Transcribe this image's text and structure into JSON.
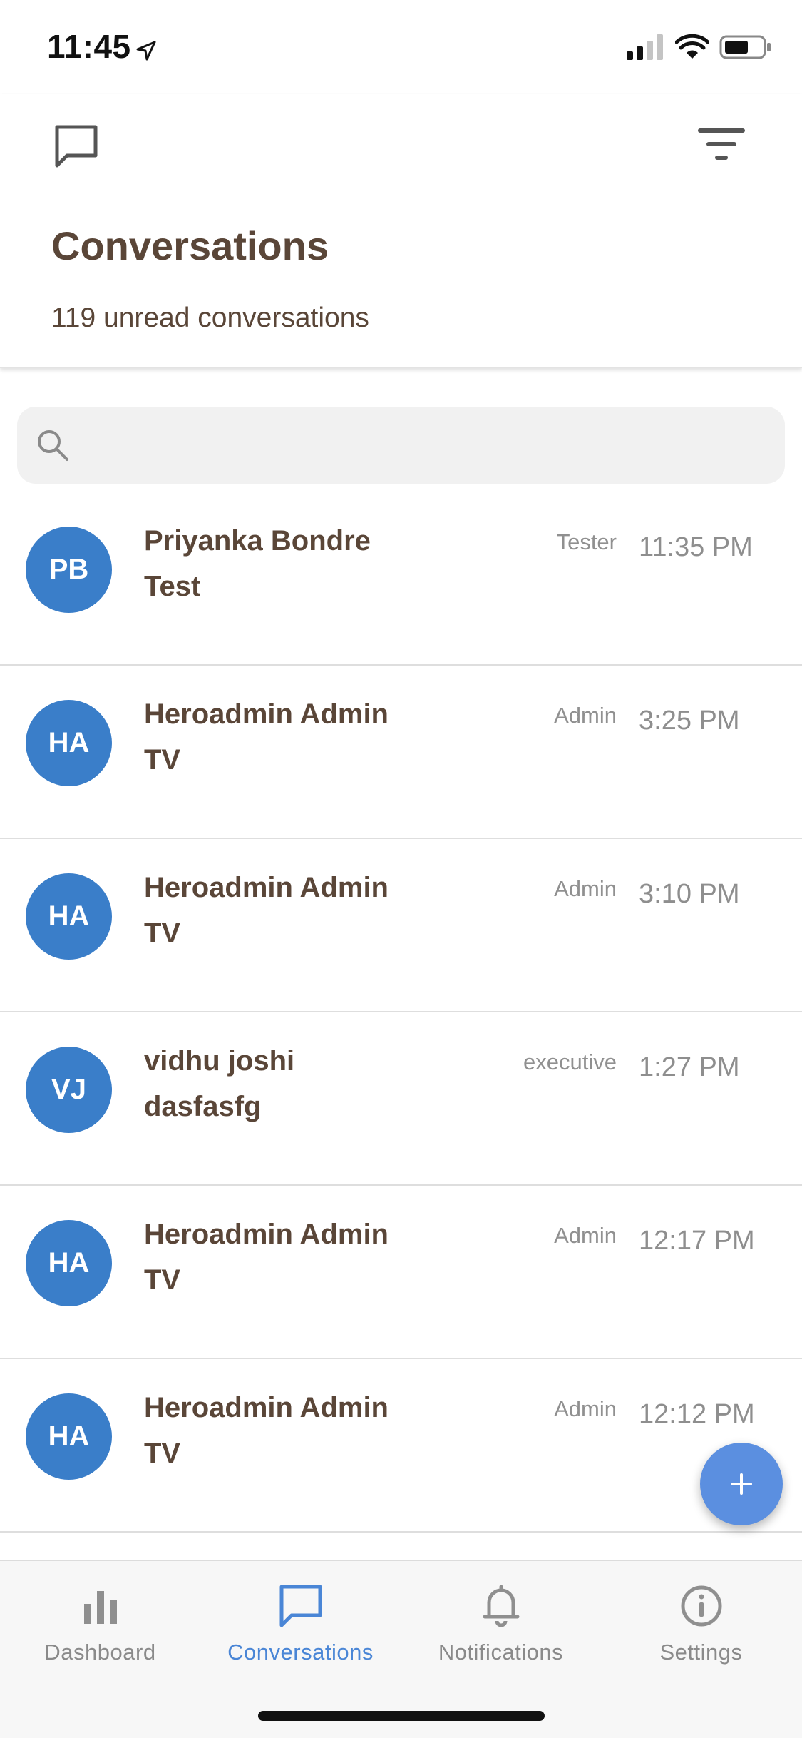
{
  "status_bar": {
    "time": "11:45",
    "icons": [
      "location-arrow-icon",
      "cellular-signal-icon",
      "wifi-icon",
      "battery-icon"
    ]
  },
  "header": {
    "left_icon": "chat-bubble-icon",
    "right_icon": "filter-icon",
    "title": "Conversations",
    "subtitle": "119 unread conversations"
  },
  "search": {
    "placeholder": "",
    "value": "",
    "icon": "search-icon"
  },
  "conversations": [
    {
      "initials": "PB",
      "name": "Priyanka Bondre",
      "message": "Test",
      "role": "Tester",
      "time": "11:35 PM"
    },
    {
      "initials": "HA",
      "name": "Heroadmin Admin",
      "message": "TV",
      "role": "Admin",
      "time": "3:25 PM"
    },
    {
      "initials": "HA",
      "name": "Heroadmin Admin",
      "message": "TV",
      "role": "Admin",
      "time": "3:10 PM"
    },
    {
      "initials": "VJ",
      "name": "vidhu joshi",
      "message": "dasfasfg",
      "role": "executive",
      "time": "1:27 PM"
    },
    {
      "initials": "HA",
      "name": "Heroadmin Admin",
      "message": "TV",
      "role": "Admin",
      "time": "12:17 PM"
    },
    {
      "initials": "HA",
      "name": "Heroadmin Admin",
      "message": "TV",
      "role": "Admin",
      "time": "12:12 PM"
    }
  ],
  "fab": {
    "icon": "plus-icon"
  },
  "tabs": [
    {
      "label": "Dashboard",
      "icon": "bar-chart-icon",
      "active": false
    },
    {
      "label": "Conversations",
      "icon": "chat-bubble-icon",
      "active": true
    },
    {
      "label": "Notifications",
      "icon": "bell-icon",
      "active": false
    },
    {
      "label": "Settings",
      "icon": "info-icon",
      "active": false
    }
  ],
  "colors": {
    "accent": "#4a86d6",
    "avatar": "#3a7ec9",
    "title_text": "#5a4638",
    "fab": "#5b8fe0"
  }
}
